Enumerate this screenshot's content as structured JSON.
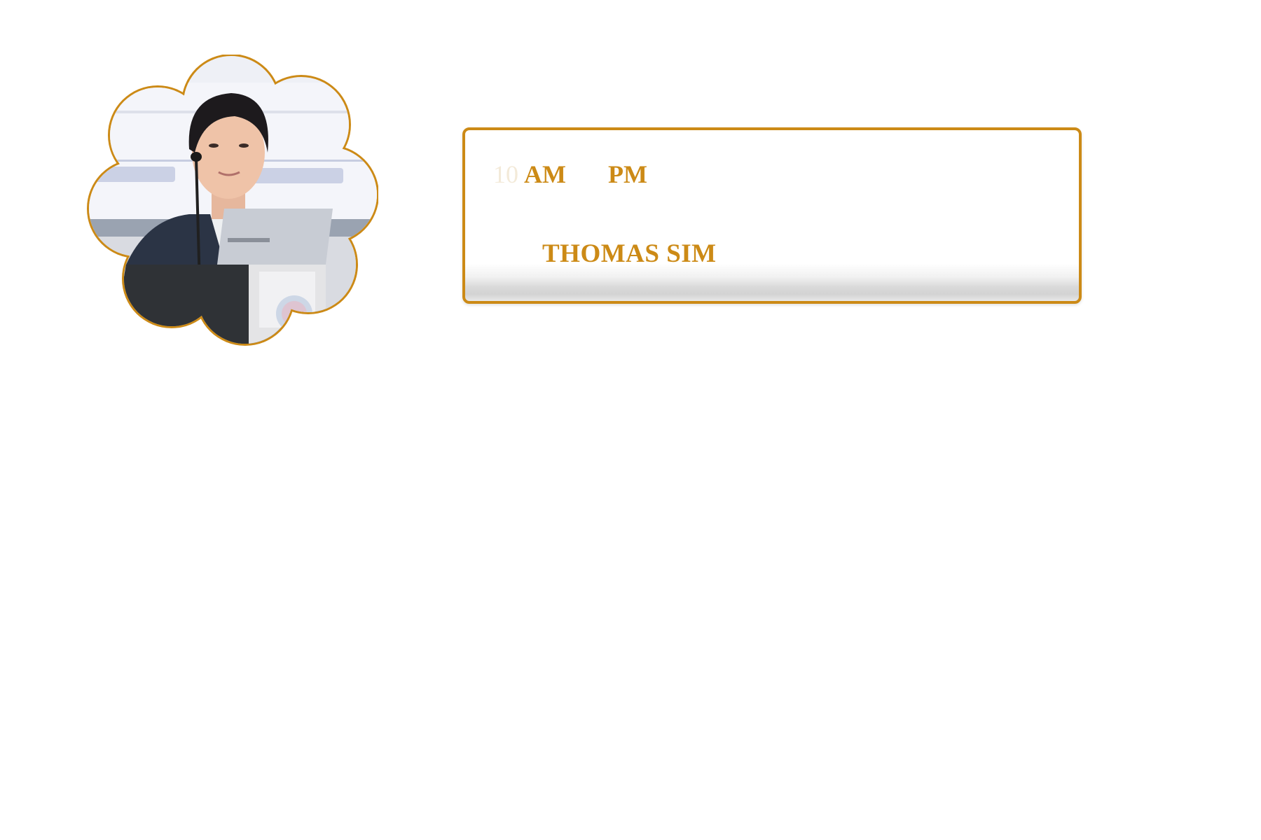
{
  "session": {
    "start_hour": "10",
    "start_meridiem": "AM",
    "end_meridiem": "PM",
    "speaker_name": "THOMAS SIM"
  },
  "colors": {
    "accent": "#cc8a16",
    "card_background": "#ffffff",
    "card_shadow_band": "#d3d3d3"
  },
  "icons": {
    "speaker_photo": "speaker-photo-scalloped-frame"
  }
}
